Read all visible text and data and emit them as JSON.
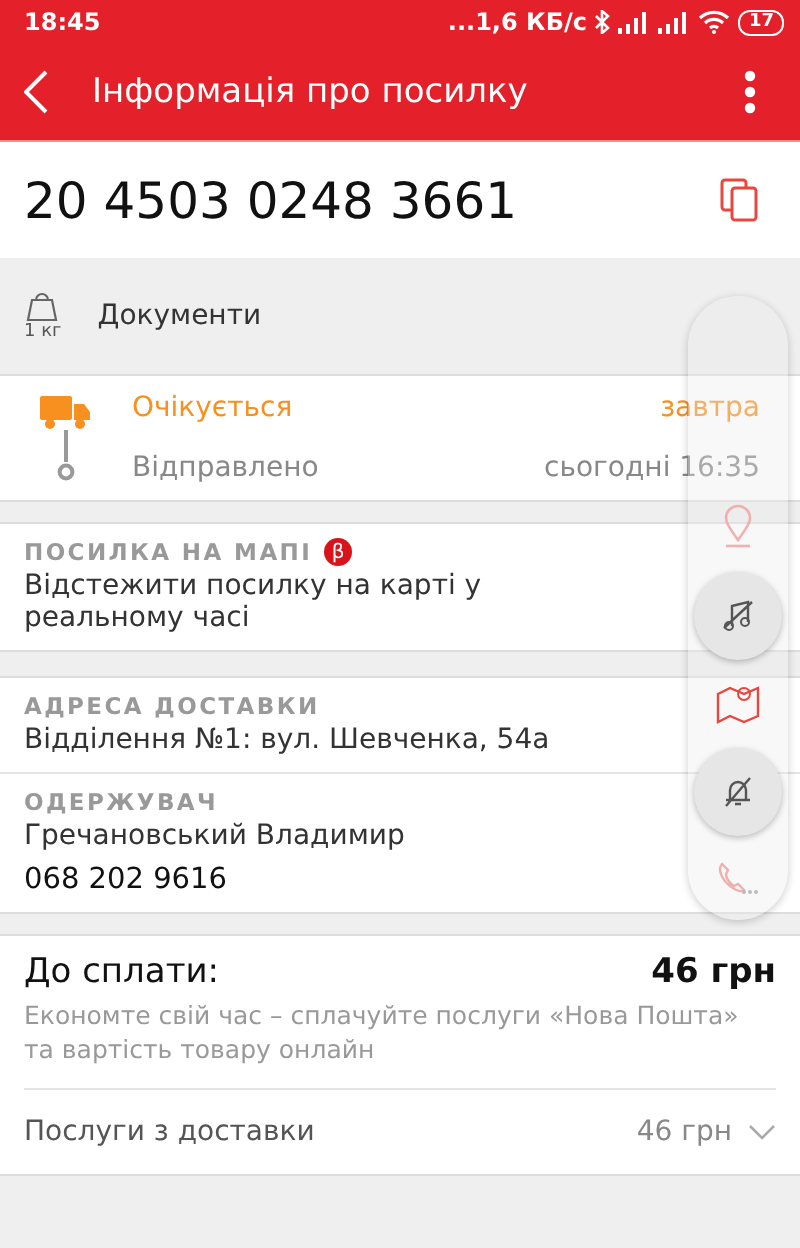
{
  "status_bar": {
    "time": "18:45",
    "speed": "...1,6 КБ/с",
    "battery": "17"
  },
  "toolbar": {
    "title": "Інформація про посилку"
  },
  "tracking_number": "20 4503 0248 3661",
  "parcel": {
    "weight": "1 кг",
    "description": "Документи"
  },
  "timeline": [
    {
      "status": "Очікується",
      "time": "завтра",
      "kind": "expected"
    },
    {
      "status": "Відправлено",
      "time": "сьогодні 16:35",
      "kind": "done"
    }
  ],
  "map_section": {
    "heading": "ПОСИЛКА НА МАПІ",
    "badge": "β",
    "text": "Відстежити посилку на карті у реальному часі"
  },
  "address": {
    "heading": "АДРЕСА ДОСТАВКИ",
    "text": "Відділення №1: вул. Шевченка, 54а"
  },
  "recipient": {
    "heading": "ОДЕРЖУВАЧ",
    "name": "Гречановський Владимир",
    "phone": "068 202 9616"
  },
  "payment": {
    "label": "До сплати:",
    "amount": "46 грн",
    "note": "Економте свій час – сплачуйте послуги «Нова Пошта» та вартість товару онлайн",
    "services_label": "Послуги з доставки",
    "services_amount": "46 грн",
    "expanded": false
  }
}
